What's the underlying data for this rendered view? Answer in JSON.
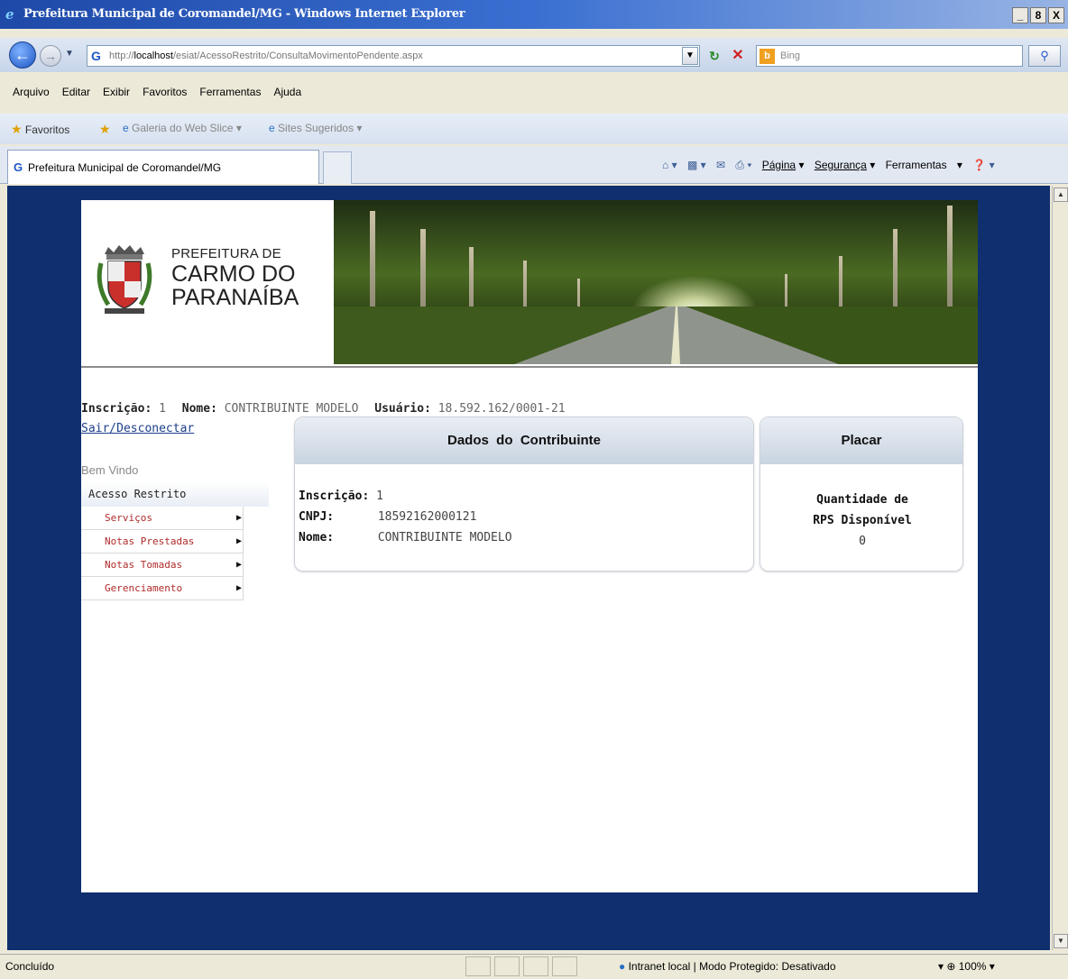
{
  "browser": {
    "title": "Prefeitura Municipal de Coromandel/MG - Windows Internet Explorer",
    "window_buttons": [
      "_",
      "8",
      "X"
    ],
    "url_prefix": "http://",
    "url_host": "localhost",
    "url_path": "/esiat/AcessoRestrito/ConsultaMovimentoPendente.aspx",
    "search_placeholder": "Bing",
    "menu": [
      "Arquivo",
      "Editar",
      "Exibir",
      "Favoritos",
      "Ferramentas",
      "Ajuda"
    ],
    "favorites": {
      "label": "Favoritos",
      "web_slice": "Galeria do Web Slice",
      "suggested": "Sites Sugeridos"
    },
    "tab_title": "Prefeitura Municipal de Coromandel/MG",
    "commands": {
      "page": "Página",
      "security": "Segurança",
      "tools": "Ferramentas"
    },
    "status": {
      "text": "Concluído",
      "zone": "Intranet local | Modo Protegido: Desativado",
      "zoom": "100%"
    }
  },
  "site": {
    "logo": {
      "line1": "PREFEITURA DE",
      "line2": "CARMO DO",
      "line3": "PARANAÍBA"
    },
    "user": {
      "inscricao_label": "Inscrição:",
      "inscricao_value": "1",
      "nome_label": "Nome:",
      "nome_value": "CONTRIBUINTE MODELO",
      "usuario_label": "Usuário:",
      "usuario_value": "18.592.162/0001-21"
    },
    "logout": "Sair/Desconectar",
    "welcome": "Bem Vindo",
    "menu": {
      "header": "Acesso Restrito",
      "items": [
        "Serviços",
        "Notas Prestadas",
        "Notas Tomadas",
        "Gerenciamento"
      ]
    },
    "dados": {
      "title": "Dados  do  Contribuinte",
      "inscricao_label": "Inscrição:",
      "inscricao_value": "1",
      "cnpj_label": "CNPJ:",
      "cnpj_value": "18592162000121",
      "nome_label": "Nome:",
      "nome_value": "CONTRIBUINTE MODELO"
    },
    "placar": {
      "title": "Placar",
      "line1": "Quantidade de",
      "line2": "RPS Disponível",
      "value": "0"
    }
  }
}
